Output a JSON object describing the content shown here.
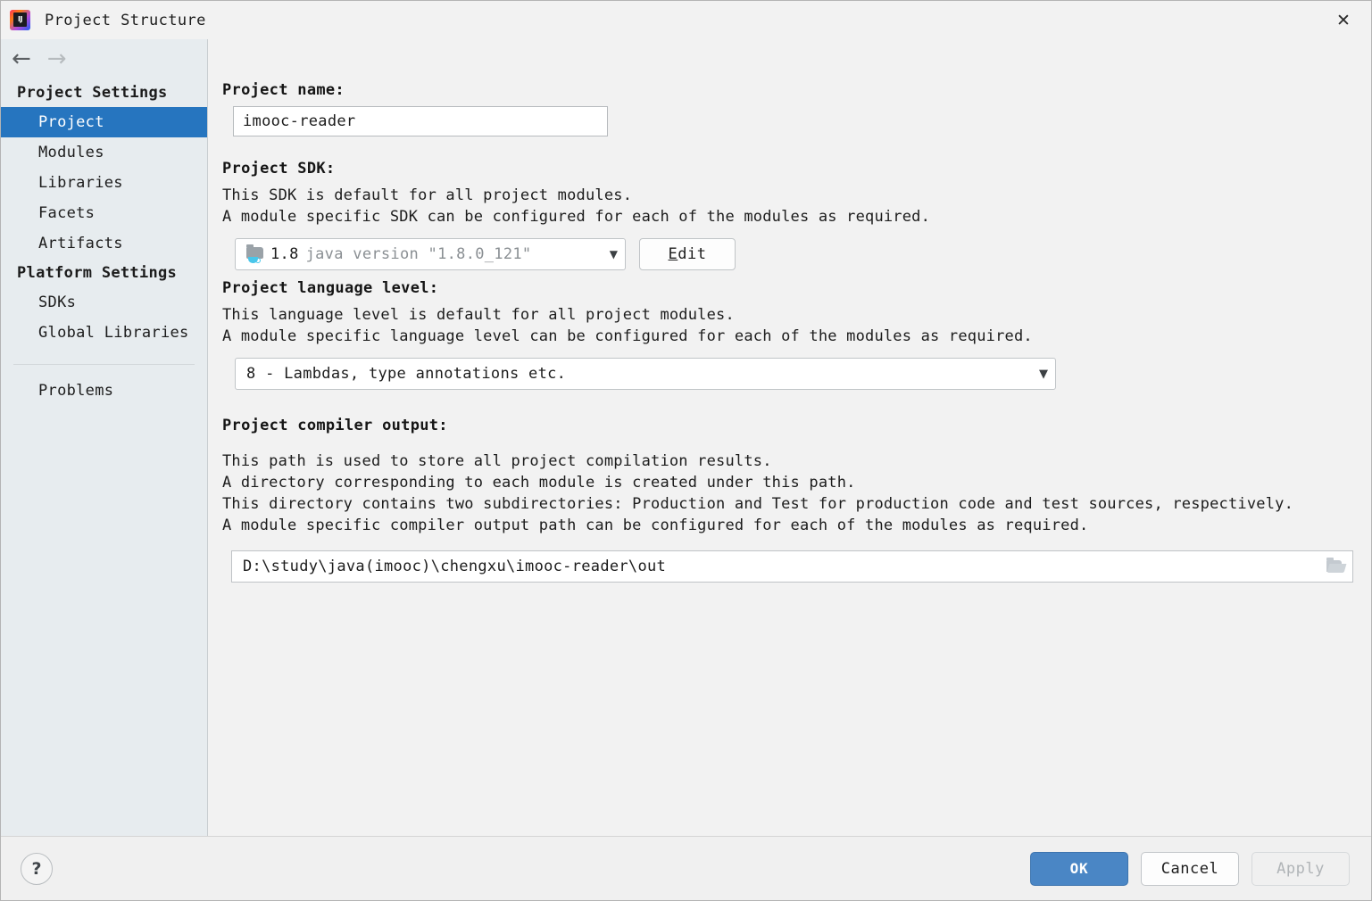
{
  "window": {
    "title": "Project Structure",
    "app_icon": "intellij-idea-logo",
    "close_label": "✕"
  },
  "nav": {
    "back_icon": "←",
    "forward_icon": "→"
  },
  "sidebar": {
    "groups": [
      {
        "title": "Project Settings",
        "items": [
          {
            "label": "Project",
            "selected": true
          },
          {
            "label": "Modules",
            "selected": false
          },
          {
            "label": "Libraries",
            "selected": false
          },
          {
            "label": "Facets",
            "selected": false
          },
          {
            "label": "Artifacts",
            "selected": false
          }
        ]
      },
      {
        "title": "Platform Settings",
        "items": [
          {
            "label": "SDKs",
            "selected": false
          },
          {
            "label": "Global Libraries",
            "selected": false
          }
        ]
      }
    ],
    "extra_items": [
      {
        "label": "Problems",
        "selected": false
      }
    ]
  },
  "main": {
    "project_name": {
      "label": "Project name:",
      "value": "imooc-reader"
    },
    "project_sdk": {
      "label": "Project SDK:",
      "description_line1": "This SDK is default for all project modules.",
      "description_line2": "A module specific SDK can be configured for each of the modules as required.",
      "selected_version": "1.8",
      "selected_description": "java version \"1.8.0_121\"",
      "sdk_icon": "jdk-folder-icon",
      "caret_icon": "▼",
      "edit_button": {
        "mnemonic": "E",
        "rest": "dit"
      }
    },
    "language_level": {
      "label": "Project language level:",
      "description_line1": "This language level is default for all project modules.",
      "description_line2": "A module specific language level can be configured for each of the modules as required.",
      "selected": "8 - Lambdas, type annotations etc.",
      "caret_icon": "▼"
    },
    "compiler_output": {
      "label": "Project compiler output:",
      "description_line1": "This path is used to store all project compilation results.",
      "description_line2": "A directory corresponding to each module is created under this path.",
      "description_line3": "This directory contains two subdirectories: Production and Test for production code and test sources, respectively.",
      "description_line4": "A module specific compiler output path can be configured for each of the modules as required.",
      "path": "D:\\study\\java(imooc)\\chengxu\\imooc-reader\\out",
      "browse_icon": "folder-browse-icon"
    }
  },
  "footer": {
    "help_label": "?",
    "ok_label": "OK",
    "cancel_label": "Cancel",
    "apply_label": "Apply"
  },
  "colors": {
    "accent": "#2675bf",
    "primary_button": "#4a86c5",
    "sidebar_bg": "#e7ecef",
    "main_bg": "#f2f2f2"
  }
}
